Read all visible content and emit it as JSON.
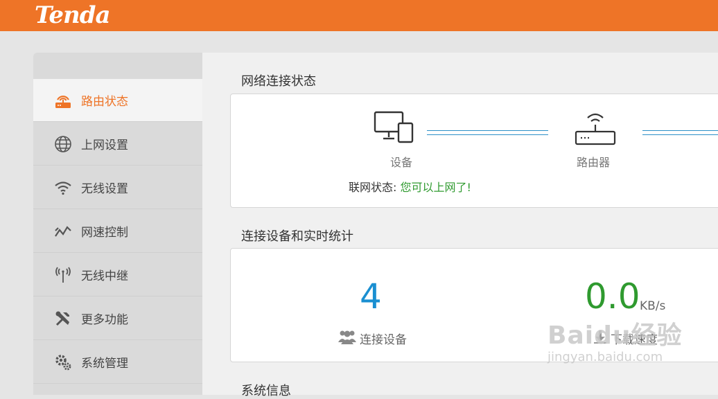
{
  "brand": {
    "logo_text": "Tenda"
  },
  "sidebar": {
    "items": [
      {
        "label": "路由状态",
        "icon": "router-status-icon",
        "active": true
      },
      {
        "label": "上网设置",
        "icon": "globe-icon"
      },
      {
        "label": "无线设置",
        "icon": "wifi-icon"
      },
      {
        "label": "网速控制",
        "icon": "speed-chart-icon"
      },
      {
        "label": "无线中继",
        "icon": "repeater-antenna-icon"
      },
      {
        "label": "更多功能",
        "icon": "tools-icon"
      },
      {
        "label": "系统管理",
        "icon": "gears-icon"
      }
    ]
  },
  "network_status": {
    "title": "网络连接状态",
    "device_label": "设备",
    "router_label": "路由器",
    "status_prefix": "联网状态:",
    "status_text": "您可以上网了!"
  },
  "stats": {
    "title": "连接设备和实时统计",
    "device_count": "4",
    "device_count_label": "连接设备",
    "download_speed": "0.0",
    "download_unit": "KB/s",
    "download_label": "下载速度"
  },
  "system_info": {
    "title": "系统信息"
  },
  "watermark": {
    "brand": "Baidu经验",
    "url": "jingyan.baidu.com"
  },
  "colors": {
    "accent": "#ee7427",
    "link_blue": "#1a8fd1",
    "ok_green": "#2f9a2f"
  }
}
